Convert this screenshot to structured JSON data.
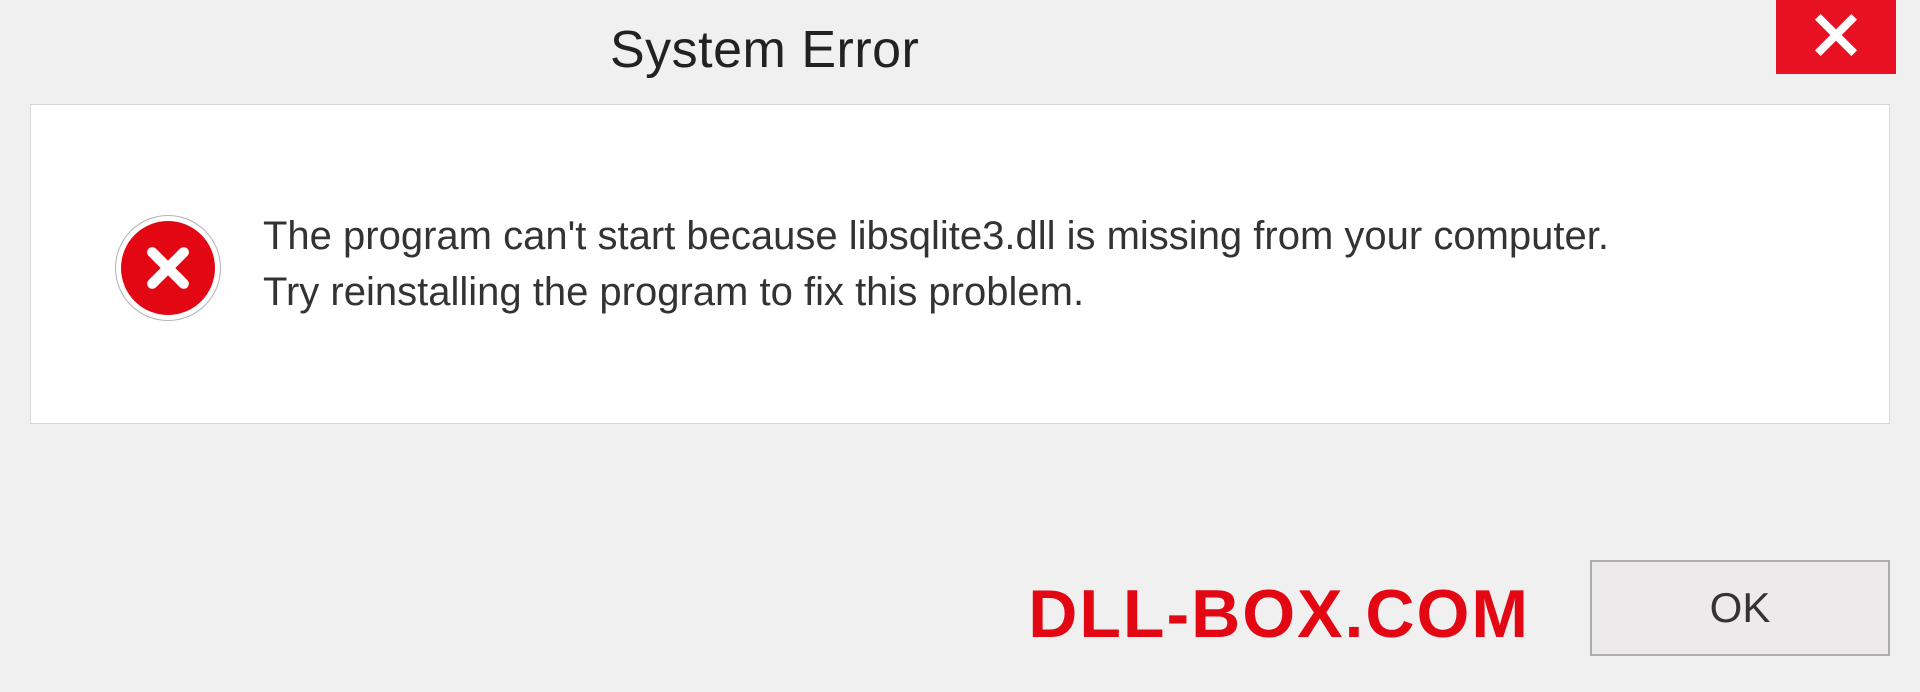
{
  "dialog": {
    "title": "System Error",
    "message": "The program can't start because libsqlite3.dll is missing from your computer. Try reinstalling the program to fix this problem.",
    "ok_label": "OK"
  },
  "watermark": "DLL-BOX.COM",
  "colors": {
    "close_bg": "#e81123",
    "error_icon": "#e30613",
    "watermark": "#e30613"
  }
}
